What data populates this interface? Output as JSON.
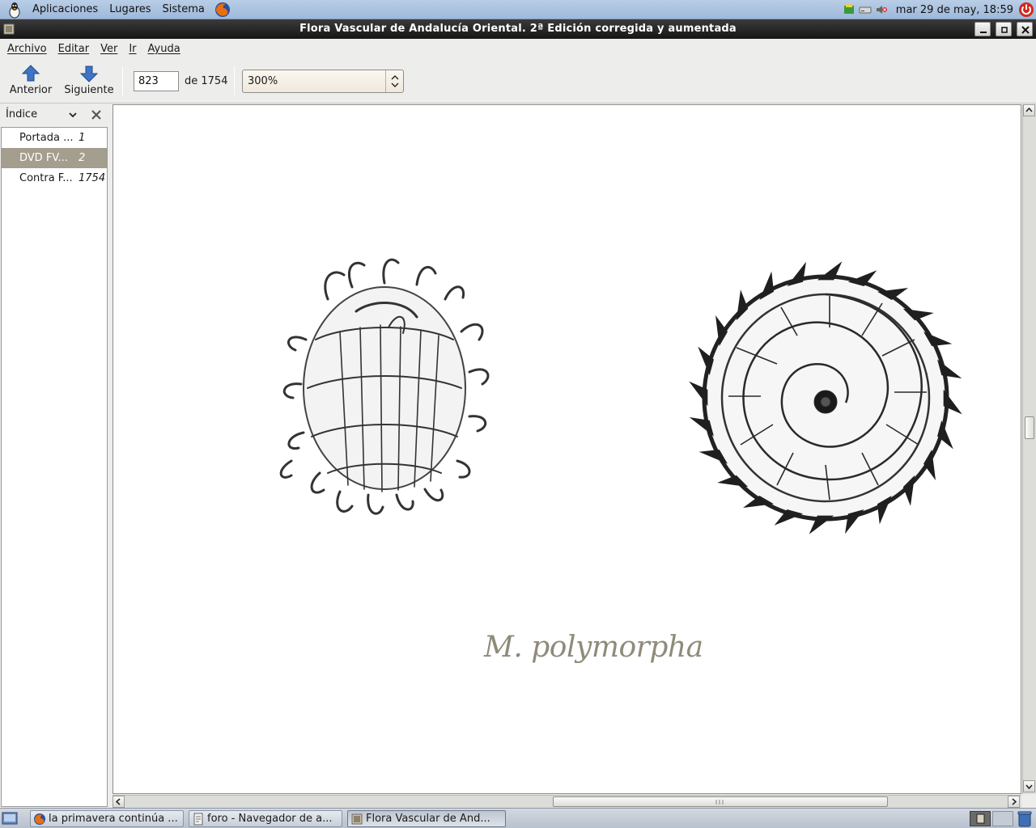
{
  "top_panel": {
    "menus": [
      "Aplicaciones",
      "Lugares",
      "Sistema"
    ],
    "clock": "mar 29 de may, 18:59"
  },
  "window": {
    "title": "Flora Vascular de Andalucía Oriental. 2ª Edición corregida y aumentada"
  },
  "menubar": {
    "items": [
      "Archivo",
      "Editar",
      "Ver",
      "Ir",
      "Ayuda"
    ]
  },
  "toolbar": {
    "prev_label": "Anterior",
    "next_label": "Siguiente",
    "page_value": "823",
    "page_total": "de 1754",
    "zoom_value": "300%"
  },
  "sidebar": {
    "title": "Índice",
    "items": [
      {
        "label": "Portada ...",
        "page": "1"
      },
      {
        "label": "DVD FV...",
        "page": "2"
      },
      {
        "label": "Contra F...",
        "page": "1754"
      }
    ],
    "selected_index": 1
  },
  "document": {
    "caption": "M. polymorpha"
  },
  "taskbar": {
    "tasks": [
      "la primavera continúa ...",
      "foro - Navegador de a...",
      "Flora Vascular de And..."
    ]
  },
  "colors": {
    "selection": "#a39e8d",
    "caption": "#8f8a7a",
    "titlebar": "#161616",
    "arrow_blue": "#2f63b4"
  }
}
